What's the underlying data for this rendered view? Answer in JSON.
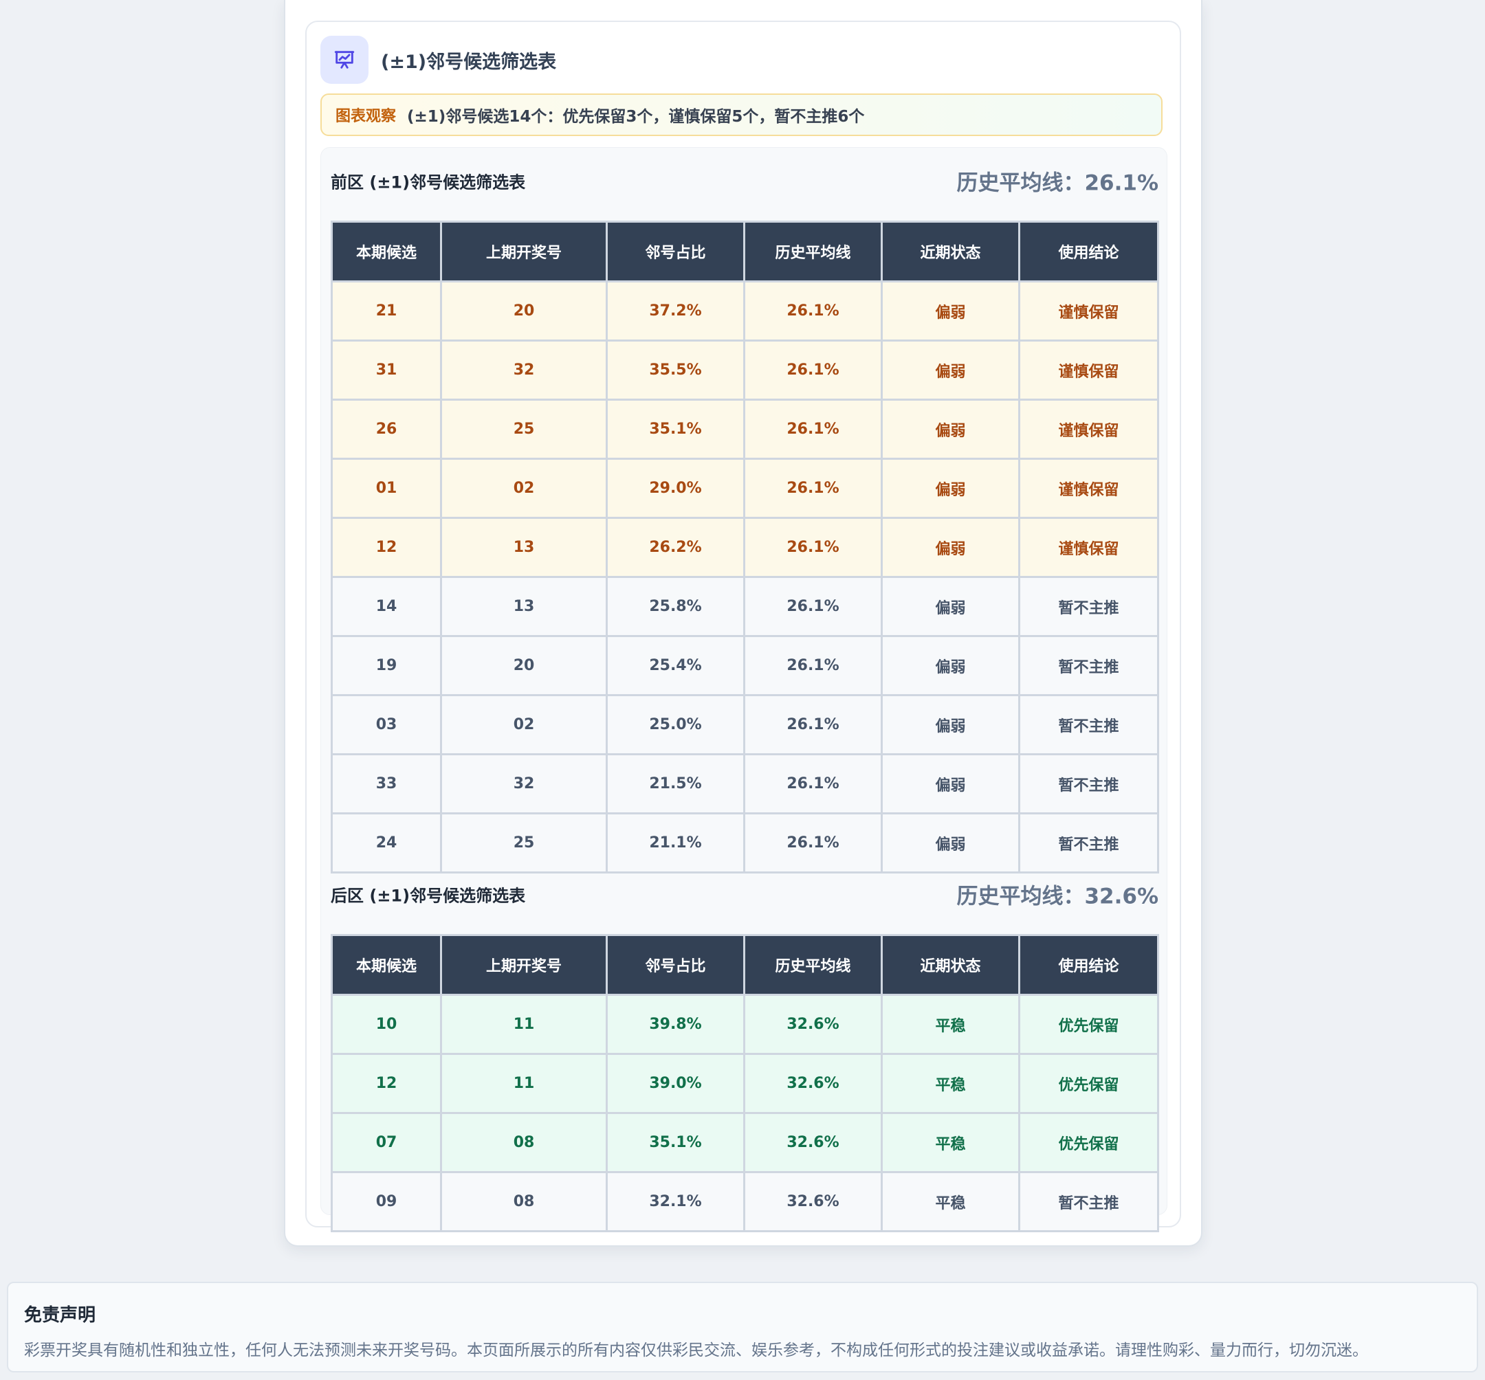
{
  "page": {
    "title": "(±1)邻号候选筛选表",
    "title_icon": "presentation-chart-icon",
    "observation": {
      "label": "图表观察",
      "text": "(±1)邻号候选14个：优先保留3个，谨慎保留5个，暂不主推6个"
    }
  },
  "columns": [
    "本期候选",
    "上期开奖号",
    "邻号占比",
    "历史平均线",
    "近期状态",
    "使用结论"
  ],
  "front": {
    "title": "前区 (±1)邻号候选筛选表",
    "average": "历史平均线：26.1%",
    "rows": [
      {
        "candidate": "21",
        "last": "20",
        "ratio": "37.2%",
        "avg": "26.1%",
        "status": "偏弱",
        "conclusion": "谨慎保留",
        "type": "caution"
      },
      {
        "candidate": "31",
        "last": "32",
        "ratio": "35.5%",
        "avg": "26.1%",
        "status": "偏弱",
        "conclusion": "谨慎保留",
        "type": "caution"
      },
      {
        "candidate": "26",
        "last": "25",
        "ratio": "35.1%",
        "avg": "26.1%",
        "status": "偏弱",
        "conclusion": "谨慎保留",
        "type": "caution"
      },
      {
        "candidate": "01",
        "last": "02",
        "ratio": "29.0%",
        "avg": "26.1%",
        "status": "偏弱",
        "conclusion": "谨慎保留",
        "type": "caution"
      },
      {
        "candidate": "12",
        "last": "13",
        "ratio": "26.2%",
        "avg": "26.1%",
        "status": "偏弱",
        "conclusion": "谨慎保留",
        "type": "caution"
      },
      {
        "candidate": "14",
        "last": "13",
        "ratio": "25.8%",
        "avg": "26.1%",
        "status": "偏弱",
        "conclusion": "暂不主推",
        "type": "neutral"
      },
      {
        "candidate": "19",
        "last": "20",
        "ratio": "25.4%",
        "avg": "26.1%",
        "status": "偏弱",
        "conclusion": "暂不主推",
        "type": "neutral"
      },
      {
        "candidate": "03",
        "last": "02",
        "ratio": "25.0%",
        "avg": "26.1%",
        "status": "偏弱",
        "conclusion": "暂不主推",
        "type": "neutral"
      },
      {
        "candidate": "33",
        "last": "32",
        "ratio": "21.5%",
        "avg": "26.1%",
        "status": "偏弱",
        "conclusion": "暂不主推",
        "type": "neutral"
      },
      {
        "candidate": "24",
        "last": "25",
        "ratio": "21.1%",
        "avg": "26.1%",
        "status": "偏弱",
        "conclusion": "暂不主推",
        "type": "neutral"
      }
    ]
  },
  "back": {
    "title": "后区 (±1)邻号候选筛选表",
    "average": "历史平均线：32.6%",
    "rows": [
      {
        "candidate": "10",
        "last": "11",
        "ratio": "39.8%",
        "avg": "32.6%",
        "status": "平稳",
        "conclusion": "优先保留",
        "type": "priority"
      },
      {
        "candidate": "12",
        "last": "11",
        "ratio": "39.0%",
        "avg": "32.6%",
        "status": "平稳",
        "conclusion": "优先保留",
        "type": "priority"
      },
      {
        "candidate": "07",
        "last": "08",
        "ratio": "35.1%",
        "avg": "32.6%",
        "status": "平稳",
        "conclusion": "优先保留",
        "type": "priority"
      },
      {
        "candidate": "09",
        "last": "08",
        "ratio": "32.1%",
        "avg": "32.6%",
        "status": "平稳",
        "conclusion": "暂不主推",
        "type": "neutral"
      }
    ]
  },
  "disclaimer": {
    "title": "免责声明",
    "text": "彩票开奖具有随机性和独立性，任何人无法预测未来开奖号码。本页面所展示的所有内容仅供彩民交流、娱乐参考，不构成任何形式的投注建议或收益承诺。请理性购彩、量力而行，切勿沉迷。"
  },
  "colors": {
    "header_bg": "#334155",
    "caution_text": "#a84a12",
    "caution_bg": "#fdf9e9",
    "priority_text": "#11704a",
    "priority_bg": "#eafaf3",
    "neutral_text": "#475569",
    "icon_accent": "#4f46e5"
  }
}
